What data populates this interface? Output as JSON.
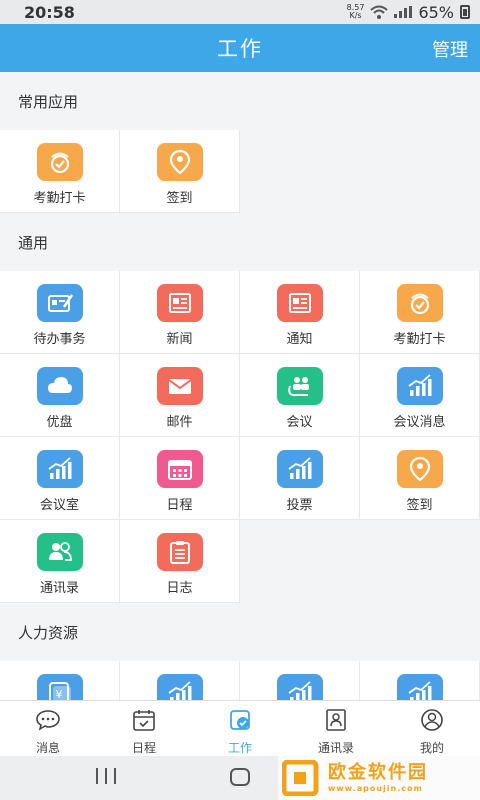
{
  "status_bar": {
    "time": "20:58",
    "net_speed_value": "8.57",
    "net_speed_unit": "K/s",
    "battery": "65%"
  },
  "header": {
    "title": "工作",
    "manage": "管理"
  },
  "sections": [
    {
      "title": "常用应用",
      "items": [
        {
          "label": "考勤打卡",
          "icon": "clock-check-icon",
          "color": "#f7a84b"
        },
        {
          "label": "签到",
          "icon": "location-pin-icon",
          "color": "#f7a84b"
        }
      ]
    },
    {
      "title": "通用",
      "items": [
        {
          "label": "待办事务",
          "icon": "todo-card-icon",
          "color": "#4a9fe6"
        },
        {
          "label": "新闻",
          "icon": "newspaper-icon",
          "color": "#f26b5b"
        },
        {
          "label": "通知",
          "icon": "notice-icon",
          "color": "#f26b5b"
        },
        {
          "label": "考勤打卡",
          "icon": "clock-check-icon",
          "color": "#f7a84b"
        },
        {
          "label": "优盘",
          "icon": "cloud-icon",
          "color": "#4a9fe6"
        },
        {
          "label": "邮件",
          "icon": "mail-icon",
          "color": "#f26b5b"
        },
        {
          "label": "会议",
          "icon": "meeting-icon",
          "color": "#25c08a"
        },
        {
          "label": "会议消息",
          "icon": "chart-icon",
          "color": "#4a9fe6"
        },
        {
          "label": "会议室",
          "icon": "chart-icon",
          "color": "#4a9fe6"
        },
        {
          "label": "日程",
          "icon": "calendar-icon",
          "color": "#f05a8f"
        },
        {
          "label": "投票",
          "icon": "chart-icon",
          "color": "#4a9fe6"
        },
        {
          "label": "签到",
          "icon": "location-pin-icon",
          "color": "#f7a84b"
        },
        {
          "label": "通讯录",
          "icon": "contacts-icon",
          "color": "#25c08a"
        },
        {
          "label": "日志",
          "icon": "clipboard-icon",
          "color": "#f26b5b"
        }
      ]
    },
    {
      "title": "人力资源",
      "items": [
        {
          "label": "",
          "icon": "salary-icon",
          "color": "#4a9fe6"
        },
        {
          "label": "",
          "icon": "chart-icon",
          "color": "#4a9fe6"
        },
        {
          "label": "",
          "icon": "chart-icon",
          "color": "#4a9fe6"
        },
        {
          "label": "",
          "icon": "chart-icon",
          "color": "#4a9fe6"
        }
      ]
    }
  ],
  "bottom_nav": [
    {
      "label": "消息",
      "icon": "chat-bubble-icon"
    },
    {
      "label": "日程",
      "icon": "calendar-icon"
    },
    {
      "label": "工作",
      "icon": "work-icon",
      "active": true
    },
    {
      "label": "通讯录",
      "icon": "address-book-icon"
    },
    {
      "label": "我的",
      "icon": "user-icon"
    }
  ],
  "watermark": {
    "name": "欧金软件园",
    "url": "www.apoujin.com"
  }
}
